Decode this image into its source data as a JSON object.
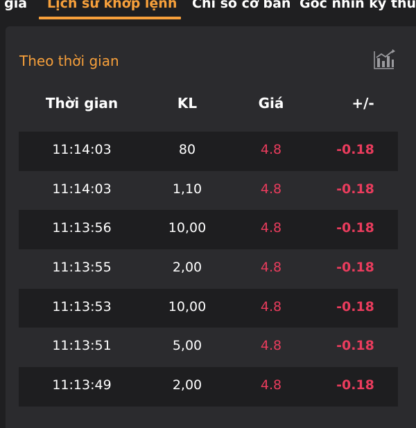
{
  "tabs": [
    {
      "label": "u giá",
      "active": false
    },
    {
      "label": "Lịch sử khớp lệnh",
      "active": true
    },
    {
      "label": "Chỉ số cơ bản",
      "active": false
    },
    {
      "label": "Góc nhìn kỹ thuật",
      "active": false
    }
  ],
  "section": {
    "title": "Theo thời gian",
    "chart_icon": "bar-chart-icon"
  },
  "table": {
    "headers": {
      "time": "Thời gian",
      "kl": "KL",
      "price": "Giá",
      "change": "+/-"
    },
    "rows": [
      {
        "time": "11:14:03",
        "kl": "80",
        "price": "4.8",
        "change": "-0.18"
      },
      {
        "time": "11:14:03",
        "kl": "1,10",
        "price": "4.8",
        "change": "-0.18"
      },
      {
        "time": "11:13:56",
        "kl": "10,00",
        "price": "4.8",
        "change": "-0.18"
      },
      {
        "time": "11:13:55",
        "kl": "2,00",
        "price": "4.8",
        "change": "-0.18"
      },
      {
        "time": "11:13:53",
        "kl": "10,00",
        "price": "4.8",
        "change": "-0.18"
      },
      {
        "time": "11:13:51",
        "kl": "5,00",
        "price": "4.8",
        "change": "-0.18"
      },
      {
        "time": "11:13:49",
        "kl": "2,00",
        "price": "4.8",
        "change": "-0.18"
      }
    ]
  },
  "colors": {
    "accent": "#f7a03b",
    "negative": "#ea3c5d",
    "background": "#1f1f21",
    "panel": "#2b2b2e",
    "row_stripe": "#1e1e20"
  }
}
